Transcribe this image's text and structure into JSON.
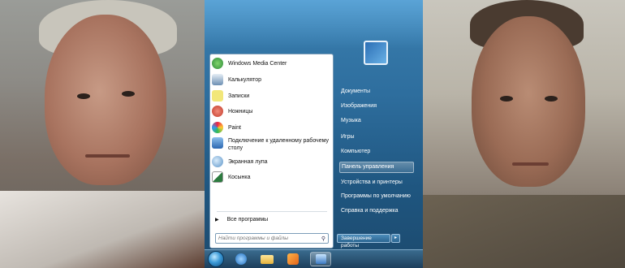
{
  "start_menu": {
    "programs": [
      {
        "label": "Windows Media Center",
        "icon": "media-center-icon",
        "color": "#2e8b3a"
      },
      {
        "label": "Калькулятор",
        "icon": "calculator-icon",
        "color": "#6c8fb3"
      },
      {
        "label": "Записки",
        "icon": "sticky-notes-icon",
        "color": "#e4d65a"
      },
      {
        "label": "Ножницы",
        "icon": "snipping-tool-icon",
        "color": "#d34b3a"
      },
      {
        "label": "Paint",
        "icon": "paint-icon",
        "color": "#4a8ed6"
      },
      {
        "label_line1": "Подключение к удаленному рабочему",
        "label_line2": "столу",
        "icon": "remote-desktop-icon",
        "color": "#3a78c2"
      },
      {
        "label": "Экранная лупа",
        "icon": "magnifier-icon",
        "color": "#5b93c7"
      },
      {
        "label": "Косынка",
        "icon": "solitaire-icon",
        "color": "#2c7b3f"
      }
    ],
    "all_programs": "Все программы",
    "search_placeholder": "Найти программы и файлы",
    "right_items": [
      {
        "label": "Документы"
      },
      {
        "label": "Изображения"
      },
      {
        "label": "Музыка"
      },
      {
        "label": "Игры"
      },
      {
        "label": "Компьютер"
      },
      {
        "label": "Панель управления",
        "highlighted": true
      },
      {
        "label": "Устройства и принтеры"
      },
      {
        "label": "Программы по умолчанию"
      },
      {
        "label": "Справка и поддержка"
      }
    ],
    "shutdown_label": "Завершение работы"
  },
  "taskbar": {
    "items": [
      {
        "icon": "start-orb-icon"
      },
      {
        "icon": "internet-explorer-icon"
      },
      {
        "icon": "explorer-folder-icon"
      },
      {
        "icon": "media-player-icon"
      },
      {
        "icon": "remote-desktop-icon",
        "active": true
      }
    ]
  }
}
